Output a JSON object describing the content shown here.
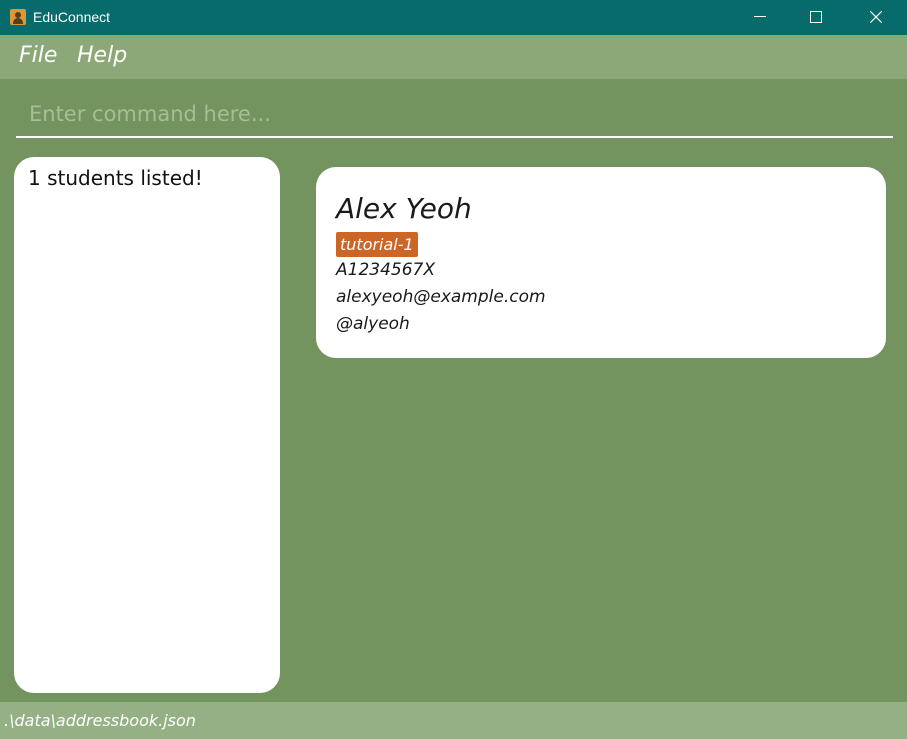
{
  "window": {
    "title": "EduConnect",
    "controls": [
      "minimize-icon",
      "maximize-icon",
      "close-icon"
    ]
  },
  "menu": {
    "items": [
      "File",
      "Help"
    ]
  },
  "command": {
    "placeholder": "Enter command here...",
    "value": ""
  },
  "result": {
    "text": "1 students listed!"
  },
  "person": {
    "name": "Alex Yeoh",
    "tag": "tutorial-1",
    "student_id": "A1234567X",
    "email": "alexyeoh@example.com",
    "handle": "@alyeoh"
  },
  "status": {
    "path": ".\\data\\addressbook.json"
  },
  "colors": {
    "titlebar": "#086b6b",
    "menubar": "#8ca878",
    "background": "#73945f",
    "tag": "#cc6627",
    "statusbar": "#95b084"
  }
}
